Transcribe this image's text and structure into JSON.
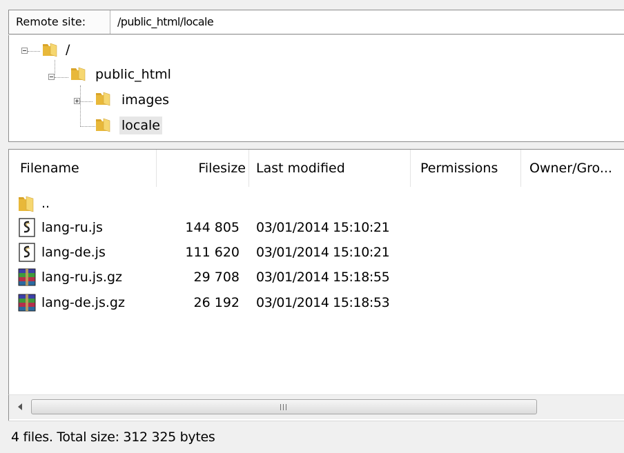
{
  "remote_site": {
    "label": "Remote site:",
    "path": "/public_html/locale"
  },
  "tree": {
    "nodes": [
      {
        "label": "/",
        "icon": "folder-icon",
        "expander": "minus"
      },
      {
        "label": "public_html",
        "icon": "folder-icon",
        "expander": "minus"
      },
      {
        "label": "images",
        "icon": "folder-icon",
        "expander": "plus"
      },
      {
        "label": "locale",
        "icon": "folder-icon",
        "expander": "none",
        "selected": true
      }
    ]
  },
  "file_list": {
    "columns": [
      "Filename",
      "Filesize",
      "Last modified",
      "Permissions",
      "Owner/Gro..."
    ],
    "rows": [
      {
        "name": "..",
        "size": "",
        "modified": "",
        "icon": "folder-icon"
      },
      {
        "name": "lang-ru.js",
        "size": "144 805",
        "modified": "03/01/2014 15:10:21",
        "icon": "script-file-icon"
      },
      {
        "name": "lang-de.js",
        "size": "111 620",
        "modified": "03/01/2014 15:10:21",
        "icon": "script-file-icon"
      },
      {
        "name": "lang-ru.js.gz",
        "size": "29 708",
        "modified": "03/01/2014 15:18:55",
        "icon": "archive-file-icon"
      },
      {
        "name": "lang-de.js.gz",
        "size": "26 192",
        "modified": "03/01/2014 15:18:53",
        "icon": "archive-file-icon"
      }
    ]
  },
  "scrollbar": {
    "left_arrow_icon": "arrow-left-icon",
    "grip_icon": "grip-icon"
  },
  "status": {
    "text": "4 files. Total size: 312 325 bytes"
  },
  "colors": {
    "folder": "#f2c84b",
    "selection": "#e6e6e6",
    "border": "#8c8c8c"
  }
}
